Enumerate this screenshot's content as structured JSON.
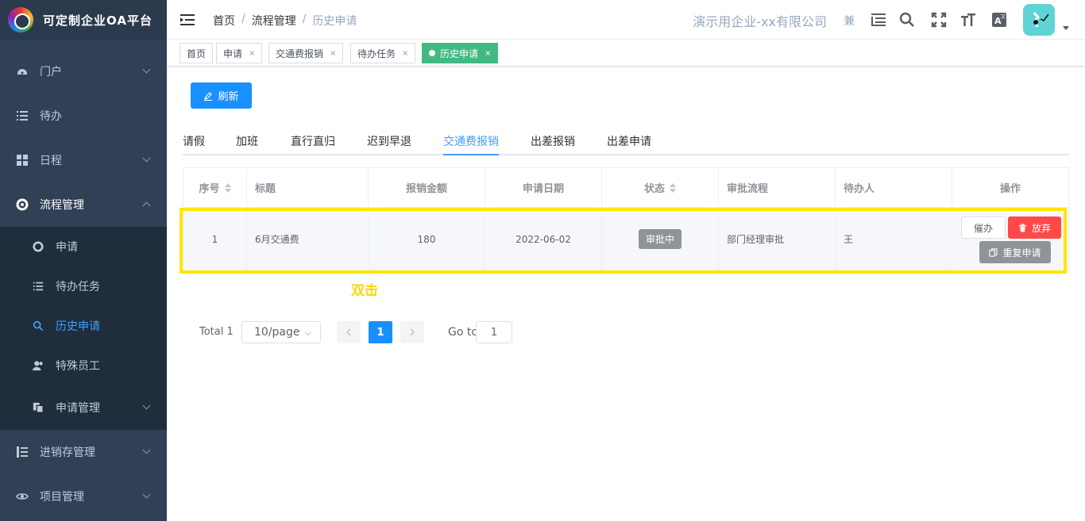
{
  "app": {
    "title": "可定制企业OA平台"
  },
  "sidebar": {
    "items": [
      {
        "label": "门户",
        "icon": "dashboard-icon"
      },
      {
        "label": "待办",
        "icon": "list-icon"
      },
      {
        "label": "日程",
        "icon": "grid-icon"
      },
      {
        "label": "流程管理",
        "icon": "gear-icon"
      },
      {
        "label": "进销存管理",
        "icon": "tree-list-icon"
      },
      {
        "label": "项目管理",
        "icon": "eye-icon"
      }
    ],
    "submenu": [
      {
        "label": "申请",
        "icon": "gear-icon"
      },
      {
        "label": "待办任务",
        "icon": "list-icon"
      },
      {
        "label": "历史申请",
        "icon": "search-icon"
      },
      {
        "label": "特殊员工",
        "icon": "user-icon"
      },
      {
        "label": "申请管理",
        "icon": "copy-icon"
      }
    ]
  },
  "header": {
    "breadcrumb": [
      "首页",
      "流程管理",
      "历史申请"
    ],
    "company": "演示用企业-xx有限公司",
    "role": "兼"
  },
  "tags": [
    {
      "label": "首页",
      "closable": false
    },
    {
      "label": "申请",
      "closable": true
    },
    {
      "label": "交通费报销",
      "closable": true
    },
    {
      "label": "待办任务",
      "closable": true
    },
    {
      "label": "历史申请",
      "closable": true,
      "active": true
    }
  ],
  "toolbar": {
    "refresh_label": "刷新"
  },
  "tabs": [
    "请假",
    "加班",
    "直行直归",
    "迟到早退",
    "交通费报销",
    "出差报销",
    "出差申请"
  ],
  "active_tab": "交通费报销",
  "table": {
    "headers": [
      "序号",
      "标题",
      "报销金额",
      "申请日期",
      "状态",
      "审批流程",
      "待办人",
      "操作"
    ],
    "rows": [
      {
        "index": "1",
        "title": "6月交通费",
        "amount": "180",
        "date": "2022-06-02",
        "status": "审批中",
        "flow": "部门经理审批",
        "assignee": "王",
        "actions": {
          "urge": "催办",
          "abandon": "放弃",
          "reapply": "重复申请"
        }
      }
    ]
  },
  "annotation": {
    "text": "双击",
    "color": "#ffe600"
  },
  "pagination": {
    "total": "Total 1",
    "page_size": "10/page",
    "current_page": "1",
    "goto_label": "Go to",
    "goto_value": "1"
  },
  "colors": {
    "sidebar": "#304156",
    "primary": "#1890ff",
    "tag_active": "#42b983",
    "danger": "#ff4949",
    "info": "#909399"
  }
}
